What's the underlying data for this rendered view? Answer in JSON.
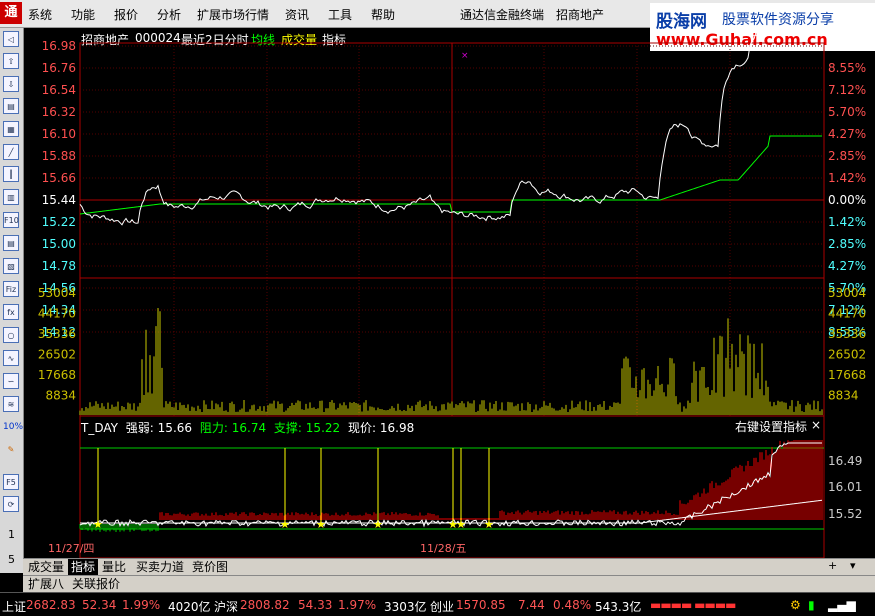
{
  "menu": {
    "items": [
      "系统",
      "功能",
      "报价",
      "分析",
      "扩展市场行情",
      "资讯",
      "工具",
      "帮助"
    ],
    "app_title": "通达信金融终端",
    "stock_name": "招商地产"
  },
  "brand": {
    "line1": "股海网",
    "line2": "股票软件资源分享",
    "line3": "www.Guhai.com.cn"
  },
  "header": {
    "stock": "招商地产",
    "code": "000024",
    "period": "最近2日分时",
    "avg_line": "均线",
    "volume": "成交量",
    "indicator": "指标"
  },
  "price_axis": {
    "left": [
      "16.98",
      "16.76",
      "16.54",
      "16.32",
      "16.10",
      "15.88",
      "15.66",
      "15.44",
      "15.22",
      "15.00",
      "14.78",
      "14.56",
      "14.34",
      "14.12"
    ],
    "right": [
      "",
      "8.55%",
      "7.12%",
      "5.70%",
      "4.27%",
      "2.85%",
      "1.42%",
      "0.00%",
      "1.42%",
      "2.85%",
      "4.27%",
      "5.70%",
      "7.12%",
      "8.55%"
    ]
  },
  "volume_axis": {
    "labels": [
      "53004",
      "44170",
      "35336",
      "26502",
      "17668",
      "8834"
    ]
  },
  "indicator_panel": {
    "name": "T_DAY",
    "strength_label": "强弱:",
    "strength": "15.66",
    "resistance_label": "阻力:",
    "resistance": "16.74",
    "support_label": "支撑:",
    "support": "15.22",
    "price_label": "现价:",
    "price": "16.98",
    "right_hint": "右键设置指标",
    "close": "×",
    "axis": [
      "16.49",
      "16.01",
      "15.52"
    ]
  },
  "dates": [
    "11/27/四",
    "11/28/五"
  ],
  "tabs": [
    "成交量",
    "指标",
    "量比",
    "买卖力道",
    "竞价图"
  ],
  "tabs2": [
    "扩展八",
    "关联报价"
  ],
  "side_numbers": [
    "1",
    "5",
    "15"
  ],
  "status": {
    "sh_label": "上证",
    "sh_val": "2682.83",
    "sh_chg": "52.34",
    "sh_pct": "1.99%",
    "sh_amt": "4020亿",
    "hs_label": "沪深",
    "hs_val": "2808.82",
    "hs_chg": "54.33",
    "hs_pct": "1.97%",
    "hs_amt": "3303亿",
    "cy_label": "创业",
    "cy_val": "1570.85",
    "cy_chg": "7.44",
    "cy_pct": "0.48%",
    "cy_amt": "543.3亿"
  },
  "colors": {
    "up": "#ff5050",
    "down": "#50ffff",
    "avg": "#00ff00",
    "price": "#ffffff",
    "vol": "#c8c800"
  }
}
